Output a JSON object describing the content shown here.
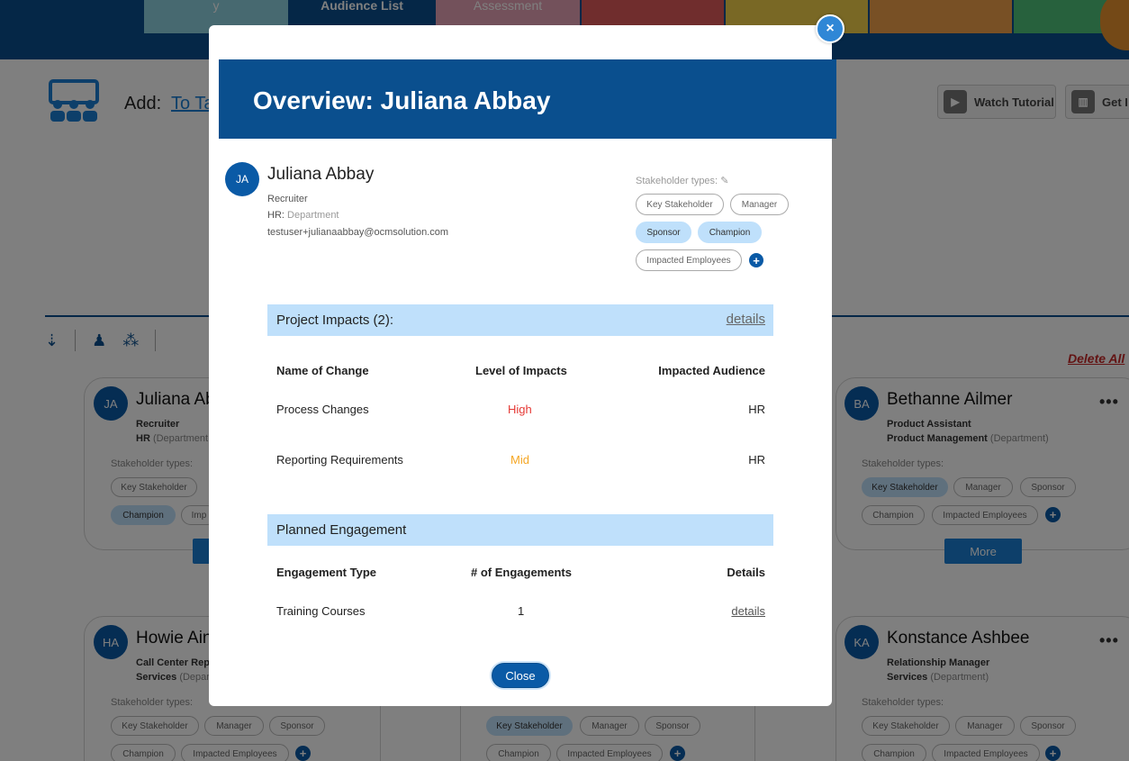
{
  "nav": {
    "tabs": [
      {
        "label": "y",
        "color": "#8fd3e0"
      },
      {
        "label": "Audience List",
        "color": "#0a4f8e"
      },
      {
        "label": "Assessment",
        "color": "#e6a3b6"
      },
      {
        "label": "",
        "color": "#e05a5a"
      },
      {
        "label": "",
        "color": "#f2d04a"
      },
      {
        "label": "",
        "color": "#f0a04a"
      },
      {
        "label": "",
        "color": "#4fc27a"
      }
    ]
  },
  "toolbar": {
    "add_label": "Add:",
    "add_link": "To Ta",
    "watch_tutorial": "Watch Tutorial",
    "get_label": "Get I"
  },
  "list": {
    "delete_all": "Delete All"
  },
  "cards": {
    "juliana": {
      "initials": "JA",
      "name": "Juliana Ab",
      "role": "Recruiter",
      "dept": "HR",
      "dept_suffix": "(Department",
      "types_label": "Stakeholder types:",
      "chips": [
        "Key Stakeholder",
        "Champion",
        "Imp"
      ],
      "more": ""
    },
    "bethanne": {
      "initials": "BA",
      "name": "Bethanne Ailmer",
      "role": "Product Assistant",
      "dept": "Product Management",
      "dept_suffix": "(Department)",
      "types_label": "Stakeholder types:",
      "chips": [
        "Key Stakeholder",
        "Manager",
        "Sponsor",
        "Champion",
        "Impacted Employees"
      ],
      "more": "More"
    },
    "howie": {
      "initials": "HA",
      "name": "Howie Ain",
      "role": "Call Center Rep",
      "dept": "Services",
      "dept_suffix": "(Depart",
      "types_label": "Stakeholder types:",
      "chips": [
        "Key Stakeholder",
        "Manager",
        "Sponsor",
        "Champion",
        "Impacted Employees"
      ]
    },
    "middle": {
      "chips": [
        "Key Stakeholder",
        "Manager",
        "Sponsor",
        "Champion",
        "Impacted Employees"
      ]
    },
    "konstance": {
      "initials": "KA",
      "name": "Konstance Ashbee",
      "role": "Relationship Manager",
      "dept": "Services",
      "dept_suffix": "(Department)",
      "types_label": "Stakeholder types:",
      "chips": [
        "Key Stakeholder",
        "Manager",
        "Sponsor",
        "Champion",
        "Impacted Employees"
      ]
    }
  },
  "modal": {
    "close_x": "×",
    "title": "Overview: Juliana Abbay",
    "person": {
      "initials": "JA",
      "name": "Juliana Abbay",
      "role": "Recruiter",
      "dept_name": "HR:",
      "dept_label": "Department",
      "email": "testuser+julianaabbay@ocmsolution.com"
    },
    "stakeholder_types_label": "Stakeholder types:",
    "chips": [
      {
        "label": "Key Stakeholder",
        "active": false
      },
      {
        "label": "Manager",
        "active": false
      },
      {
        "label": "Sponsor",
        "active": true
      },
      {
        "label": "Champion",
        "active": true
      },
      {
        "label": "Impacted Employees",
        "active": false
      }
    ],
    "impacts": {
      "title": "Project Impacts (2):",
      "link": "details",
      "headers": [
        "Name of Change",
        "Level of Impacts",
        "Impacted Audience"
      ],
      "rows": [
        {
          "name": "Process Changes",
          "level": "High",
          "audience": "HR"
        },
        {
          "name": "Reporting Requirements",
          "level": "Mid",
          "audience": "HR"
        }
      ]
    },
    "engagement": {
      "title": "Planned Engagement",
      "headers": [
        "Engagement Type",
        "# of Engagements",
        "Details"
      ],
      "rows": [
        {
          "type": "Training Courses",
          "count": "1",
          "details": "details"
        }
      ]
    },
    "close_button": "Close"
  }
}
